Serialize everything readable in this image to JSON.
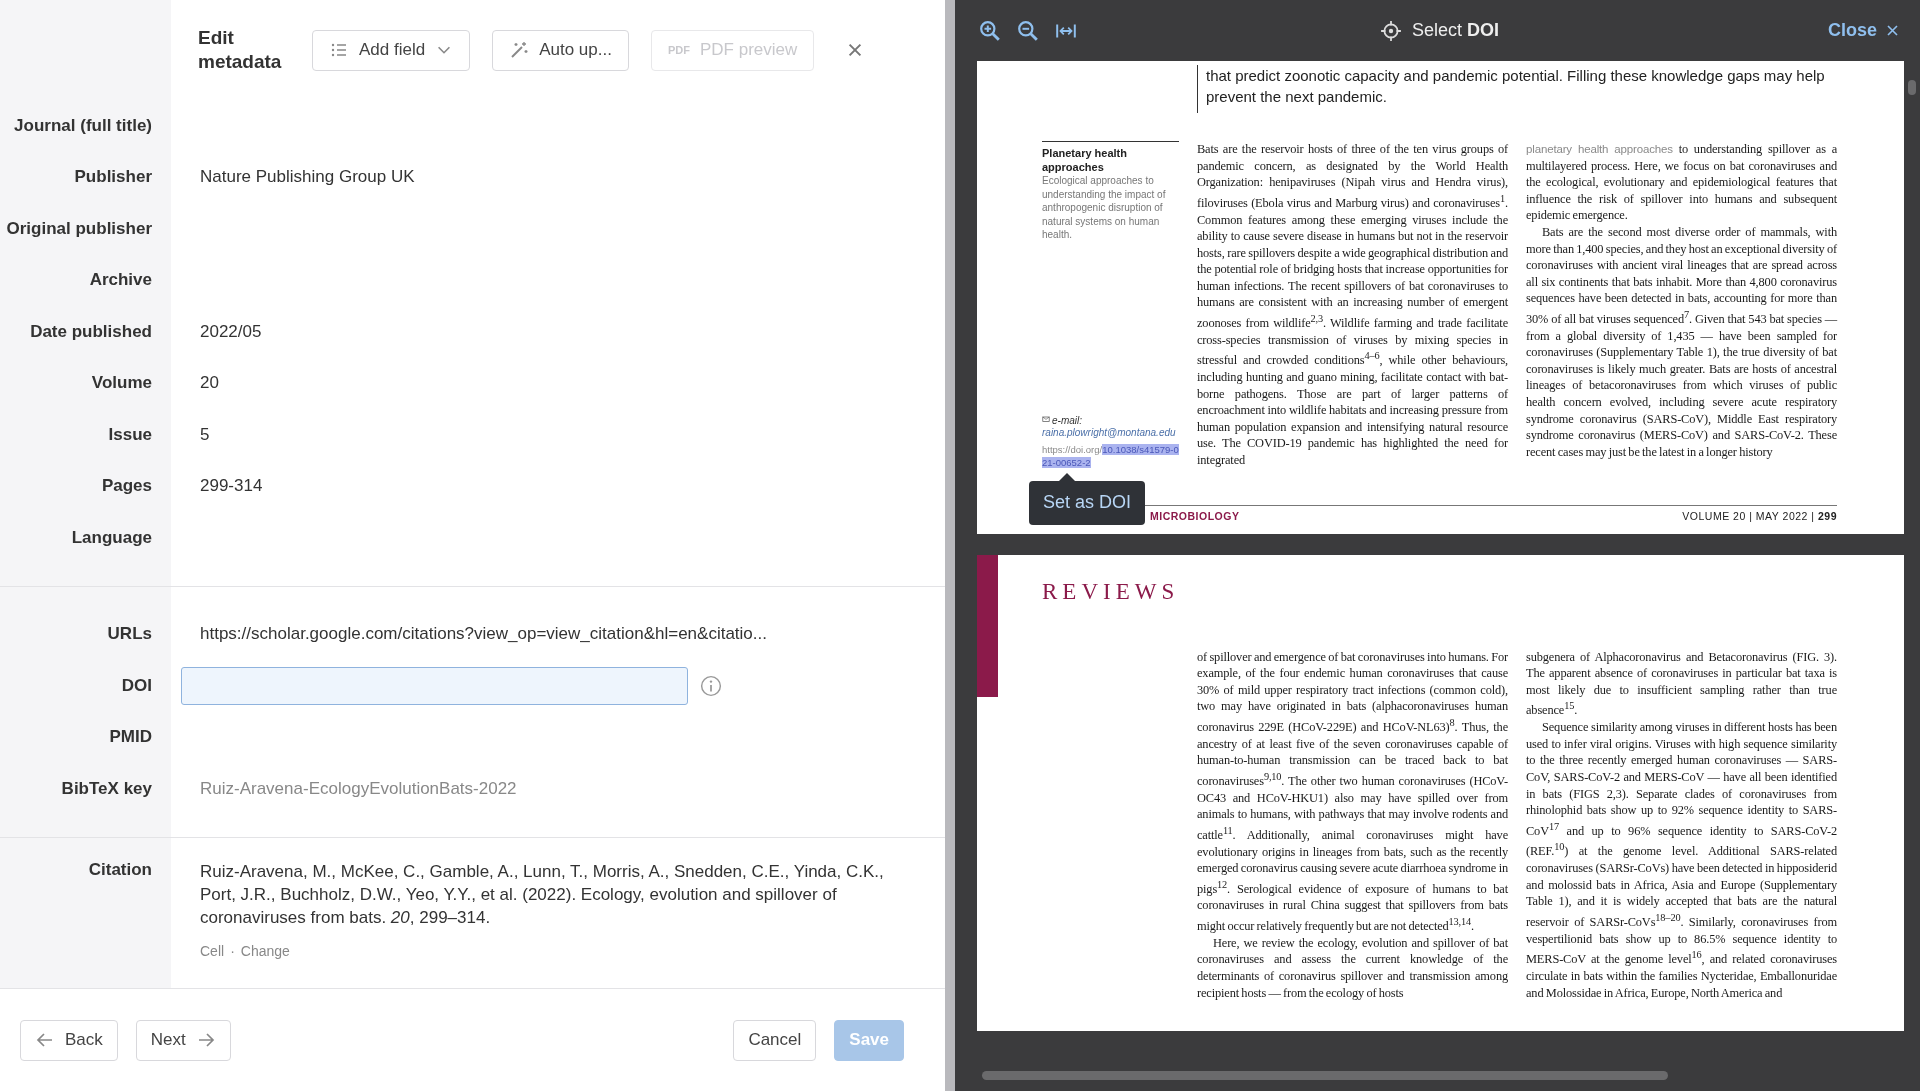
{
  "editor": {
    "title": "Edit metadata",
    "toolbar": [
      {
        "label": "Add field",
        "disabled": false
      },
      {
        "label": "Auto up...",
        "disabled": false
      },
      {
        "label": "PDF preview",
        "badge": "PDF",
        "disabled": true
      }
    ],
    "sections": [
      {
        "fields": [
          {
            "label": "Journal (full title)",
            "kind": "text"
          },
          {
            "label": "Publisher",
            "kind": "text",
            "value": "Nature Publishing Group UK"
          },
          {
            "label": "Original publisher",
            "kind": "text"
          },
          {
            "label": "Archive",
            "kind": "text"
          },
          {
            "label": "Date published",
            "kind": "text",
            "value": "2022/05"
          },
          {
            "label": "Volume",
            "kind": "text",
            "value": "20"
          },
          {
            "label": "Issue",
            "kind": "text",
            "value": "5"
          },
          {
            "label": "Pages",
            "kind": "text",
            "value": "299-314"
          },
          {
            "label": "Language",
            "kind": "text"
          }
        ]
      },
      {
        "fields": [
          {
            "label": "URLs",
            "kind": "text",
            "value": "https://scholar.google.com/citations?view_op=view_citation&hl=en&citatio..."
          },
          {
            "label": "DOI",
            "kind": "input",
            "focused": true
          },
          {
            "label": "PMID",
            "kind": "text"
          },
          {
            "label": "BibTeX key",
            "kind": "placeholder",
            "placeholder": "Ruiz-Aravena-EcologyEvolutionBats-2022"
          }
        ]
      },
      {
        "fields": [
          {
            "label": "Citation",
            "kind": "citation",
            "value": "Ruiz-Aravena, M., McKee, C., Gamble, A., Lunn, T., Morris, A., Snedden, C.E., Yinda, C.K., Port, J.R., Buchholz, D.W., Yeo, Y.Y., et al. (2022). Ecology, evolution and spillover of coronaviruses from bats. *20*, 299–314.",
            "style": "Cell",
            "separator": "·",
            "link": "Change"
          }
        ]
      }
    ],
    "nav": [
      {
        "label": "Back"
      },
      {
        "label": "Next"
      }
    ],
    "actions": [
      {
        "label": "Cancel",
        "kind": "default",
        "disabled": false
      },
      {
        "label": "Save",
        "kind": "primary",
        "disabled": true
      }
    ]
  },
  "viewer": {
    "title": "Select **DOI**",
    "close": "Close",
    "pages": [
      {
        "kind": "continued",
        "quote": "that predict zoonotic capacity and pandemic potential. Filling these knowledge gaps may help prevent the next pandemic.",
        "sidebar": {
          "term": "Planetary health approaches",
          "definition": "Ecological approaches to understanding the impact of anthropogenic disruption of natural systems on human health.",
          "email_label": "e-mail:",
          "email": "raina.plowright@montana.edu",
          "doi_prefix": "https://doi.org/",
          "doi_selected": "10.1038/s41579-021-00652-2"
        },
        "columns": [
          [
            {
              "indent": false,
              "text": "Bats are the reservoir hosts of three of the ten virus groups of pandemic concern, as designated by the World Health Organization: henipaviruses (Nipah virus and Hendra virus), filoviruses (Ebola virus and Marburg virus) and coronaviruses$^{1}$. Common features among these emerging viruses include the ability to cause severe disease in humans but not in the reservoir hosts, rare spillovers despite a wide geographical distribution and the potential role of bridging hosts that increase opportunities for human infections. The recent spillovers of bat coronaviruses to humans are consistent with an increasing number of emergent zoonoses from wildlife$^{2,3}$. Wildlife farming and trade facilitate cross-species transmission of viruses by mixing species in stressful and crowded conditions$^{4–6}$, while other behaviours, including hunting and guano mining, facilitate contact with bat-borne pathogens. Those are part of larger patterns of encroachment into wildlife habitats and increasing pressure from human population expansion and intensifying natural resource use. The COVID-19 pandemic has highlighted the need for integrated"
            }
          ],
          [
            {
              "indent": false,
              "term": "planetary health approaches",
              "text": " to understanding spillover as a multilayered process. Here, we focus on bat coronaviruses and the ecological, evolutionary and epidemiological features that influence the risk of spillover into humans and subsequent epidemic emergence."
            },
            {
              "indent": true,
              "text": "Bats are the second most diverse order of mammals, with more than 1,400 species, and they host an exceptional diversity of coronaviruses with ancient viral lineages that are spread across all six continents that bats inhabit. More than 4,800 coronavirus sequences have been detected in bats, accounting for more than 30% of all bat viruses sequenced$^{7}$. Given that 543 bat species — from a global diversity of 1,435 — have been sampled for coronaviruses (Supplementary Table 1), the true diversity of bat coronaviruses is likely much greater. Bats are hosts of ancestral lineages of betacoronaviruses from which viruses of public health concern evolved, including severe acute respiratory syndrome coronavirus (SARS-CoV), Middle East respiratory syndrome coronavirus (MERS-CoV) and SARS-CoV-2. These recent cases may just be the latest in a longer history"
            }
          ]
        ],
        "footer": {
          "journal": "MICROBIOLOGY",
          "issue": "VOLUME 20 | MAY 2022 | **299**"
        },
        "tooltip": "Set as DOI"
      },
      {
        "kind": "section-start",
        "heading": "REVIEWS",
        "columns": [
          [
            {
              "indent": false,
              "text": "of spillover and emergence of bat coronaviruses into humans. For example, of the four endemic human coronaviruses that cause 30% of mild upper respiratory tract infections (common cold), two may have originated in bats (alphacoronaviruses human coronavirus 229E (HCoV-229E) and HCoV-NL63)$^{8}$. Thus, the ancestry of at least five of the seven coronaviruses capable of human-to-human transmission can be traced back to bat coronaviruses$^{9,10}$. The other two human coronaviruses (HCoV-OC43 and HCoV-HKU1) also may have spilled over from animals to humans, with pathways that may involve rodents and cattle$^{11}$. Additionally, animal coronaviruses might have evolutionary origins in lineages from bats, such as the recently emerged coronavirus causing severe acute diarrhoea syndrome in pigs$^{12}$. Serological evidence of exposure of humans to bat coronaviruses in rural China suggest that spillovers from bats might occur relatively frequently but are not detected$^{13,14}$."
            },
            {
              "indent": true,
              "text": "Here, we review the ecology, evolution and spillover of bat coronaviruses and assess the current knowledge of the determinants of coronavirus spillover and transmission among recipient hosts — from the ecology of hosts"
            }
          ],
          [
            {
              "indent": false,
              "text": "subgenera of Alphacoronavirus and Betacoronavirus (FIG. 3). The apparent absence of coronaviruses in particular bat taxa is most likely due to insufficient sampling rather than true absence$^{15}$."
            },
            {
              "indent": true,
              "text": "Sequence similarity among viruses in different hosts has been used to infer viral origins. Viruses with high sequence similarity to the three recently emerged human coronaviruses — SARS-CoV, SARS-CoV-2 and MERS-CoV — have all been identified in bats (FIGS 2,3). Separate clades of coronaviruses from rhinolophid bats show up to 92% sequence identity to SARS-CoV$^{17}$ and up to 96% sequence identity to SARS-CoV-2 (REF.$^{10}$) at the genome level. Additional SARS-related coronaviruses (SARSr-CoVs) have been detected in hipposiderid and molossid bats in Africa, Asia and Europe (Supplementary Table 1), and it is widely accepted that bats are the natural reservoir of SARSr-CoVs$^{18–20}$. Similarly, coronaviruses from vespertilionid bats show up to 86.5% sequence identity to MERS-CoV at the genome level$^{16}$, and related coronaviruses circulate in bats within the families Nycteridae, Emballonuridae and Molossidae in Africa, Europe, North America and"
            }
          ]
        ]
      }
    ]
  }
}
